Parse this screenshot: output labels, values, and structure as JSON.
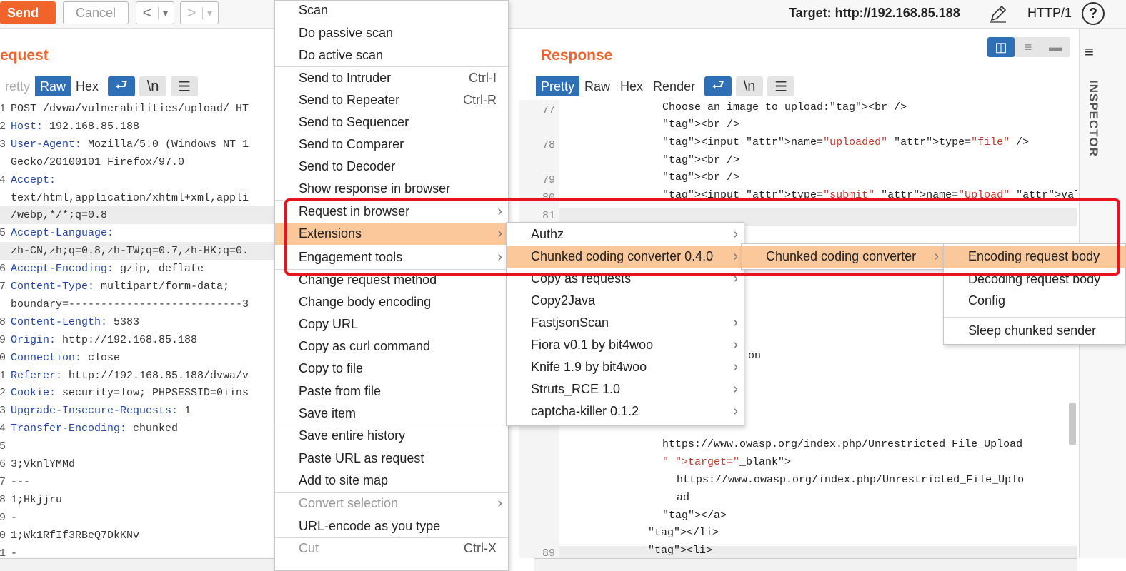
{
  "toolbar": {
    "send_label": "Send",
    "cancel_label": "Cancel",
    "back_icon": "<",
    "back_dropdown_icon": "▾",
    "forward_icon": ">",
    "forward_dropdown_icon": "▾",
    "target_label": "Target: http://192.168.85.188",
    "http_version": "HTTP/1",
    "help_icon": "?"
  },
  "request": {
    "title": "equest",
    "tabs": [
      "retty",
      "Raw",
      "Hex"
    ],
    "active_tab": "Raw",
    "lines": [
      {
        "n": "1",
        "k": "",
        "v": "POST /dvwa/vulnerabilities/upload/ HT"
      },
      {
        "n": "2",
        "k": "Host:",
        "v": " 192.168.85.188"
      },
      {
        "n": "3",
        "k": "User-Agent:",
        "v": " Mozilla/5.0 (Windows NT 1"
      },
      {
        "n": "",
        "k": "",
        "v": "Gecko/20100101 Firefox/97.0"
      },
      {
        "n": "4",
        "k": "Accept:",
        "v": ""
      },
      {
        "n": "",
        "k": "",
        "v": "text/html,application/xhtml+xml,appli"
      },
      {
        "n": "",
        "k": "",
        "v": "/webp,*/*;q=0.8"
      },
      {
        "n": "5",
        "k": "Accept-Language:",
        "v": ""
      },
      {
        "n": "",
        "k": "",
        "v": "zh-CN,zh;q=0.8,zh-TW;q=0.7,zh-HK;q=0."
      },
      {
        "n": "6",
        "k": "Accept-Encoding:",
        "v": " gzip, deflate"
      },
      {
        "n": "7",
        "k": "Content-Type:",
        "v": " multipart/form-data;"
      },
      {
        "n": "",
        "k": "",
        "v": "boundary=---------------------------3"
      },
      {
        "n": "8",
        "k": "Content-Length:",
        "v": " 5383"
      },
      {
        "n": "9",
        "k": "Origin:",
        "v": " http://192.168.85.188"
      },
      {
        "n": "0",
        "k": "Connection:",
        "v": " close"
      },
      {
        "n": "1",
        "k": "Referer:",
        "v": " http://192.168.85.188/dvwa/v"
      },
      {
        "n": "2",
        "k": "Cookie:",
        "v": " security=low; PHPSESSID=0iins"
      },
      {
        "n": "3",
        "k": "Upgrade-Insecure-Requests:",
        "v": " 1"
      },
      {
        "n": "4",
        "k": "Transfer-Encoding:",
        "v": " chunked"
      },
      {
        "n": "5",
        "k": "",
        "v": ""
      },
      {
        "n": "6",
        "k": "",
        "v": "3;VknlYMMd"
      },
      {
        "n": "7",
        "k": "",
        "v": "---"
      },
      {
        "n": "8",
        "k": "",
        "v": "1;Hkjjru"
      },
      {
        "n": "9",
        "k": "",
        "v": "-"
      },
      {
        "n": "0",
        "k": "",
        "v": "1;Wk1RfIf3RBeQ7DkKNv"
      },
      {
        "n": "1",
        "k": "",
        "v": "-"
      }
    ]
  },
  "response": {
    "title": "Response",
    "tabs": [
      "Pretty",
      "Raw",
      "Hex",
      "Render"
    ],
    "active_tab": "Pretty",
    "lines": [
      {
        "n": "77",
        "t": "Choose an image to upload:<br />"
      },
      {
        "n": "",
        "t": "<br />"
      },
      {
        "n": "78",
        "t": "<input name=\"uploaded\" type=\"file\" />"
      },
      {
        "n": "",
        "t": "<br />"
      },
      {
        "n": "79",
        "t": "<br />"
      },
      {
        "n": "80",
        "t": "<input type=\"submit\" name=\"Upload\" value=\"Upload\" />"
      },
      {
        "n": "81",
        "t": ""
      },
      {
        "n": "",
        "t": "on"
      },
      {
        "n": "",
        "t": "https://www.owasp.org/index.php/Unrestricted_File_Upload"
      },
      {
        "n": "",
        "t": "\" target=\"_blank\">"
      },
      {
        "n": "",
        "t": "https://www.owasp.org/index.php/Unrestricted_File_Uplo"
      },
      {
        "n": "",
        "t": "ad"
      },
      {
        "n": "",
        "t": "</a>"
      },
      {
        "n": "",
        "t": "</li>"
      },
      {
        "n": "89",
        "t": "<li>"
      }
    ]
  },
  "inspector": {
    "label": "INSPECTOR",
    "menu_icon": "≡"
  },
  "context_menu": {
    "items": [
      {
        "label": "Scan",
        "shortcut": "",
        "submenu": false,
        "disabled": false
      },
      {
        "label": "Do passive scan",
        "shortcut": "",
        "submenu": false,
        "disabled": false
      },
      {
        "label": "Do active scan",
        "shortcut": "",
        "submenu": false,
        "disabled": false
      },
      {
        "label": "Send to Intruder",
        "shortcut": "Ctrl-I",
        "submenu": false,
        "disabled": false
      },
      {
        "label": "Send to Repeater",
        "shortcut": "Ctrl-R",
        "submenu": false,
        "disabled": false
      },
      {
        "label": "Send to Sequencer",
        "shortcut": "",
        "submenu": false,
        "disabled": false
      },
      {
        "label": "Send to Comparer",
        "shortcut": "",
        "submenu": false,
        "disabled": false
      },
      {
        "label": "Send to Decoder",
        "shortcut": "",
        "submenu": false,
        "disabled": false
      },
      {
        "label": "Show response in browser",
        "shortcut": "",
        "submenu": false,
        "disabled": false
      },
      {
        "label": "Request in browser",
        "shortcut": "",
        "submenu": true,
        "disabled": false
      },
      {
        "label": "Extensions",
        "shortcut": "",
        "submenu": true,
        "disabled": false,
        "selected": true
      },
      {
        "label": "Engagement tools",
        "shortcut": "",
        "submenu": true,
        "disabled": false
      },
      {
        "label": "Change request method",
        "shortcut": "",
        "submenu": false,
        "disabled": false
      },
      {
        "label": "Change body encoding",
        "shortcut": "",
        "submenu": false,
        "disabled": false
      },
      {
        "label": "Copy URL",
        "shortcut": "",
        "submenu": false,
        "disabled": false
      },
      {
        "label": "Copy as curl command",
        "shortcut": "",
        "submenu": false,
        "disabled": false
      },
      {
        "label": "Copy to file",
        "shortcut": "",
        "submenu": false,
        "disabled": false
      },
      {
        "label": "Paste from file",
        "shortcut": "",
        "submenu": false,
        "disabled": false
      },
      {
        "label": "Save item",
        "shortcut": "",
        "submenu": false,
        "disabled": false
      },
      {
        "label": "Save entire history",
        "shortcut": "",
        "submenu": false,
        "disabled": false
      },
      {
        "label": "Paste URL as request",
        "shortcut": "",
        "submenu": false,
        "disabled": false
      },
      {
        "label": "Add to site map",
        "shortcut": "",
        "submenu": false,
        "disabled": false
      },
      {
        "label": "Convert selection",
        "shortcut": "",
        "submenu": true,
        "disabled": true
      },
      {
        "label": "URL-encode as you type",
        "shortcut": "",
        "submenu": false,
        "disabled": false
      },
      {
        "label": "Cut",
        "shortcut": "Ctrl-X",
        "submenu": false,
        "disabled": true
      }
    ]
  },
  "extensions_menu": {
    "items": [
      {
        "label": "Authz"
      },
      {
        "label": "Chunked coding converter 0.4.0",
        "selected": true
      },
      {
        "label": "Copy as requests"
      },
      {
        "label": "Copy2Java",
        "noarrow": true
      },
      {
        "label": "FastjsonScan"
      },
      {
        "label": "Fiora v0.1 by bit4woo"
      },
      {
        "label": "Knife 1.9 by bit4woo"
      },
      {
        "label": "Struts_RCE 1.0"
      },
      {
        "label": "captcha-killer 0.1.2"
      }
    ]
  },
  "chunked_menu": {
    "items": [
      {
        "label": "Chunked coding converter",
        "selected": true
      }
    ]
  },
  "chunked_actions_menu": {
    "items": [
      {
        "label": "Encoding request body",
        "selected": true
      },
      {
        "label": "Decoding request body"
      },
      {
        "label": "Config"
      },
      {
        "label": "Sleep chunked sender"
      }
    ]
  },
  "colors": {
    "accent": "#f0642c",
    "selected_tab": "#2f6fb6",
    "menu_selection": "#fbc89b",
    "highlight_box": "#e8131f"
  }
}
